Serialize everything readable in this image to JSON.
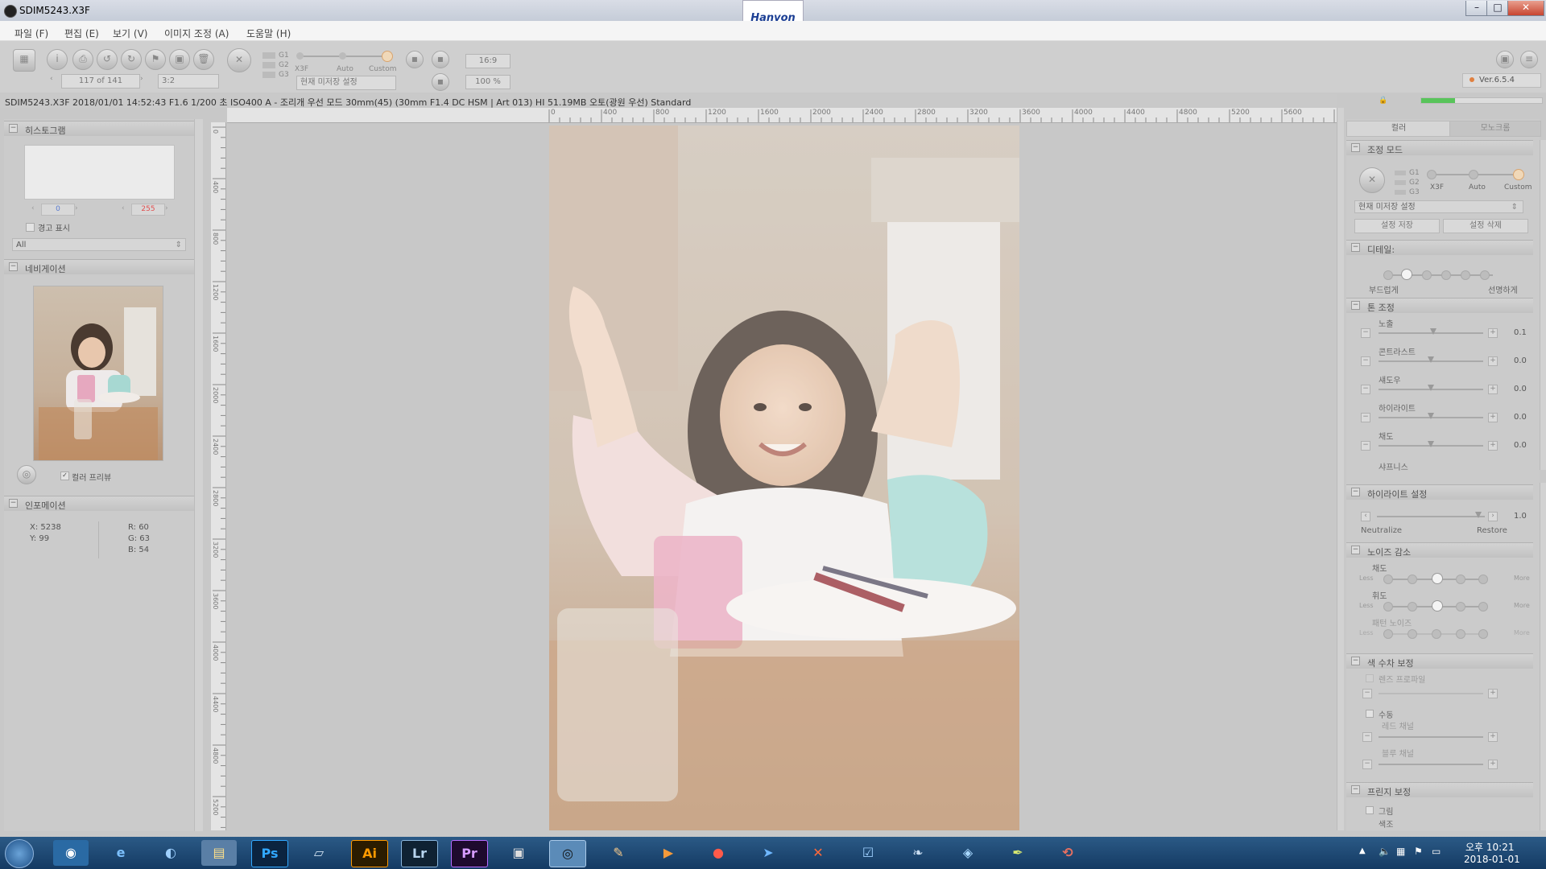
{
  "window": {
    "title": "SDIM5243.X3F",
    "brand": "Hanvon"
  },
  "menu": [
    "파일 (F)",
    "편집 (E)",
    "보기 (V)",
    "이미지 조정 (A)",
    "도움말 (H)"
  ],
  "toolbar": {
    "counter": "117 of 141",
    "ratio": "3:2",
    "g_labels": [
      "G1",
      "G2",
      "G3"
    ],
    "mode_labels": [
      "X3F",
      "Auto",
      "Custom"
    ],
    "preset": "현재 미저장 설정",
    "zoom_1": "16:9",
    "zoom_2": "100 %",
    "version": "Ver.6.5.4"
  },
  "infobar": {
    "text": "SDIM5243.X3F 2018/01/01 14:52:43 F1.6 1/200 초 ISO400 A - 조리개 우선 모드 30mm(45) (30mm F1.4 DC HSM | Art 013) HI 51.19MB 오토(광원 우선) Standard"
  },
  "ruler": {
    "top": [
      "0",
      "400",
      "800",
      "1200",
      "1600",
      "2000",
      "2400",
      "2800",
      "3200",
      "3600",
      "4000",
      "4400",
      "4800",
      "5200",
      "5600"
    ],
    "left": [
      "0",
      "400",
      "800",
      "1200",
      "1600",
      "2000",
      "2400",
      "2800",
      "3200",
      "3600",
      "4000",
      "4400",
      "4800",
      "5200"
    ]
  },
  "left": {
    "histogram": {
      "title": "히스토그램",
      "low": "0",
      "high": "255",
      "warning_label": "경고 표시",
      "channel": "All"
    },
    "navigation": {
      "title": "네비게이션",
      "color_preview": "컬러 프리뷰"
    },
    "information": {
      "title": "인포메이션",
      "x": "X:  5238",
      "y": "Y:  99",
      "r": "R:  60",
      "g": "G:  63",
      "b": "B:  54"
    }
  },
  "right": {
    "tabs": [
      "컬러",
      "모노크롬"
    ],
    "mode": {
      "title": "조정 모드",
      "g_labels": [
        "G1",
        "G2",
        "G3"
      ],
      "mode_labels": [
        "X3F",
        "Auto",
        "Custom"
      ],
      "preset": "현재 미저장 설정",
      "save": "설정 저장",
      "delete": "설정 삭제"
    },
    "detail": {
      "title": "디테일:",
      "soft": "부드럽게",
      "sharp": "선명하게"
    },
    "tone": {
      "title": "톤 조정",
      "rows": [
        {
          "label": "노출",
          "value": "0.1"
        },
        {
          "label": "콘트라스트",
          "value": "0.0"
        },
        {
          "label": "섀도우",
          "value": "0.0"
        },
        {
          "label": "하이라이트",
          "value": "0.0"
        },
        {
          "label": "채도",
          "value": "0.0"
        }
      ],
      "sharpness": "샤프니스"
    },
    "highlight": {
      "title": "하이라이트 설정",
      "value": "1.0",
      "neutralize": "Neutralize",
      "restore": "Restore"
    },
    "noise": {
      "title": "노이즈 감소",
      "chroma": "채도",
      "luma": "휘도",
      "pattern": "패턴 노이즈",
      "less": "Less",
      "more": "More"
    },
    "aberration": {
      "title": "색 수차 보정",
      "lens_profile": "렌즈 프로파일",
      "manual": "수동",
      "red": "레드 채널",
      "blue": "블루 채널"
    },
    "fringe": {
      "title": "프린지 보정",
      "shadow": "그림",
      "color": "색조"
    }
  },
  "taskbar": {
    "apps": [
      "Ps",
      "Ai",
      "Lr",
      "Pr"
    ],
    "time": "오후 10:21",
    "date": "2018-01-01"
  },
  "colors": {
    "taskbar": "#1e4a78",
    "accent": "#4caf50",
    "warn": "#e05050"
  }
}
